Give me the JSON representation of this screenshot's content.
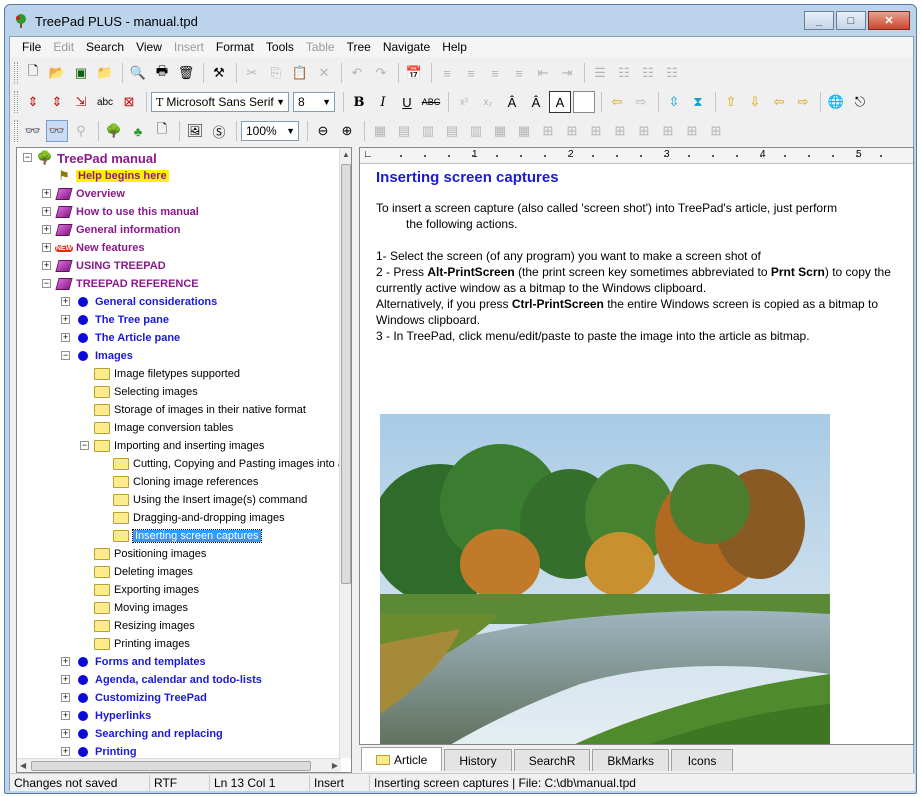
{
  "window": {
    "title": "TreePad PLUS - manual.tpd"
  },
  "menu": [
    {
      "label": "File",
      "enabled": true
    },
    {
      "label": "Edit",
      "enabled": false
    },
    {
      "label": "Search",
      "enabled": true
    },
    {
      "label": "View",
      "enabled": true
    },
    {
      "label": "Insert",
      "enabled": false
    },
    {
      "label": "Format",
      "enabled": true
    },
    {
      "label": "Tools",
      "enabled": true
    },
    {
      "label": "Table",
      "enabled": false
    },
    {
      "label": "Tree",
      "enabled": true
    },
    {
      "label": "Navigate",
      "enabled": true
    },
    {
      "label": "Help",
      "enabled": true
    }
  ],
  "toolbar2": {
    "font_name": "Microsoft Sans Serif",
    "font_size": "8"
  },
  "toolbar3": {
    "zoom": "100%"
  },
  "tree": [
    {
      "label": "TreePad manual",
      "style": "root",
      "icon": "tree-icon",
      "expander": "−"
    },
    {
      "label": "Help begins here",
      "style": "highlight",
      "icon": "signpost-icon",
      "expander": ""
    },
    {
      "label": "Overview",
      "style": "purple",
      "icon": "book-icon",
      "expander": "+"
    },
    {
      "label": "How to use this manual",
      "style": "purple",
      "icon": "book-icon",
      "expander": "+"
    },
    {
      "label": "General information",
      "style": "purple",
      "icon": "book-icon",
      "expander": "+"
    },
    {
      "label": "New features",
      "style": "purple",
      "icon": "new-badge-icon",
      "expander": "+"
    },
    {
      "label": "USING TREEPAD",
      "style": "purple",
      "icon": "book-icon",
      "expander": "+"
    },
    {
      "label": "TREEPAD REFERENCE",
      "style": "purple",
      "icon": "book-icon",
      "expander": "−"
    },
    {
      "label": "General considerations",
      "style": "blue",
      "icon": "dot-icon",
      "expander": "+"
    },
    {
      "label": "The Tree pane",
      "style": "blue",
      "icon": "dot-icon",
      "expander": "+"
    },
    {
      "label": "The Article pane",
      "style": "blue",
      "icon": "dot-icon",
      "expander": "+"
    },
    {
      "label": "Images",
      "style": "blue",
      "icon": "dot-icon",
      "expander": "−"
    },
    {
      "label": "Image filetypes supported",
      "style": "plain",
      "icon": "folder-icon",
      "expander": ""
    },
    {
      "label": "Selecting images",
      "style": "plain",
      "icon": "folder-icon",
      "expander": ""
    },
    {
      "label": "Storage of images in their native format",
      "style": "plain",
      "icon": "folder-icon",
      "expander": ""
    },
    {
      "label": "Image conversion tables",
      "style": "plain",
      "icon": "folder-icon",
      "expander": ""
    },
    {
      "label": "Importing and inserting images",
      "style": "plain",
      "icon": "folder-icon",
      "expander": "−"
    },
    {
      "label": "Cutting, Copying and Pasting images into a",
      "style": "plain",
      "icon": "folder-icon",
      "expander": ""
    },
    {
      "label": "Cloning image references",
      "style": "plain",
      "icon": "folder-icon",
      "expander": ""
    },
    {
      "label": "Using the Insert image(s) command",
      "style": "plain",
      "icon": "folder-icon",
      "expander": ""
    },
    {
      "label": "Dragging-and-dropping images",
      "style": "plain",
      "icon": "folder-icon",
      "expander": ""
    },
    {
      "label": "Inserting screen captures",
      "style": "selected",
      "icon": "folder-icon",
      "expander": ""
    },
    {
      "label": "Positioning images",
      "style": "plain",
      "icon": "folder-icon",
      "expander": ""
    },
    {
      "label": "Deleting images",
      "style": "plain",
      "icon": "folder-icon",
      "expander": ""
    },
    {
      "label": "Exporting images",
      "style": "plain",
      "icon": "folder-icon",
      "expander": ""
    },
    {
      "label": "Moving images",
      "style": "plain",
      "icon": "folder-icon",
      "expander": ""
    },
    {
      "label": "Resizing images",
      "style": "plain",
      "icon": "folder-icon",
      "expander": ""
    },
    {
      "label": "Printing images",
      "style": "plain",
      "icon": "folder-icon",
      "expander": ""
    },
    {
      "label": "Forms and templates",
      "style": "blue",
      "icon": "dot-icon",
      "expander": "+"
    },
    {
      "label": "Agenda, calendar and todo-lists",
      "style": "blue",
      "icon": "dot-icon",
      "expander": "+"
    },
    {
      "label": "Customizing TreePad",
      "style": "blue",
      "icon": "dot-icon",
      "expander": "+"
    },
    {
      "label": "Hyperlinks",
      "style": "blue",
      "icon": "dot-icon",
      "expander": "+"
    },
    {
      "label": "Searching and replacing",
      "style": "blue",
      "icon": "dot-icon",
      "expander": "+"
    },
    {
      "label": "Printing",
      "style": "blue",
      "icon": "dot-icon",
      "expander": "+"
    }
  ],
  "ruler": {
    "marks": [
      "1",
      "2",
      "3",
      "4",
      "5"
    ]
  },
  "article": {
    "title": "Inserting screen captures",
    "intro_line1": "To insert a screen capture (also called 'screen shot') into TreePad's article, just perform",
    "intro_line2": "the following actions.",
    "step1": "1- Select the screen (of any program) you want to make a screen shot of",
    "step2_a": "2 - Press ",
    "step2_key1": "Alt-PrintScreen",
    "step2_b": " (the print screen key sometimes abbreviated to ",
    "step2_key2": "Prnt Scrn",
    "step2_c": ") to copy the currently active window as a bitmap to the Windows clipboard.",
    "alt_a": "Alternatively, if you press ",
    "alt_key": "Ctrl-PrintScreen",
    "alt_b": " the entire Windows screen is copied as a bitmap to Windows clipboard.",
    "step3": "3 - In TreePad, click menu/edit/paste to paste the image into the article as bitmap."
  },
  "tabs": [
    {
      "label": "Article",
      "active": true
    },
    {
      "label": "History",
      "active": false
    },
    {
      "label": "SearchR",
      "active": false
    },
    {
      "label": "BkMarks",
      "active": false
    },
    {
      "label": "Icons",
      "active": false
    }
  ],
  "status": {
    "saved": "Changes not saved",
    "format": "RTF",
    "position": "Ln 13  Col 1",
    "mode": "Insert",
    "info": "Inserting screen captures  |  File: C:\\db\\manual.tpd"
  },
  "colors": {
    "node_purple": "#8a1a8a",
    "node_blue": "#1a1ad8",
    "highlight_yellow": "#fff200",
    "selection": "#3399ff",
    "article_title": "#1a1ad8"
  }
}
